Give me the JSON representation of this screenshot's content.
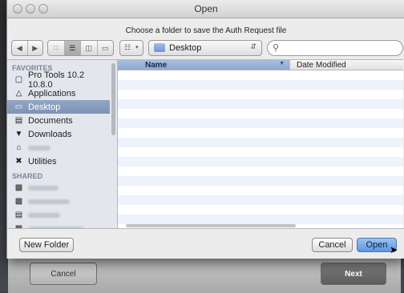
{
  "window": {
    "title": "Open",
    "prompt": "Choose a folder to save the Auth Request file"
  },
  "toolbar": {
    "back_icon": "chevron-left",
    "forward_icon": "chevron-right",
    "view_icons": [
      "icon-view",
      "list-view",
      "column-view",
      "coverflow-view"
    ],
    "arrange_icon": "arrange-grid",
    "location": "Desktop",
    "search_value": ""
  },
  "sidebar": {
    "favorites_header": "FAVORITES",
    "favorites": [
      {
        "label": "Pro Tools 10.2 10.8.0",
        "icon": "disk-icon"
      },
      {
        "label": "Applications",
        "icon": "applications-icon"
      },
      {
        "label": "Desktop",
        "icon": "desktop-icon",
        "selected": true
      },
      {
        "label": "Documents",
        "icon": "documents-icon"
      },
      {
        "label": "Downloads",
        "icon": "downloads-icon"
      },
      {
        "label": "",
        "icon": "home-icon",
        "redacted": true
      },
      {
        "label": "Utilities",
        "icon": "utilities-icon"
      }
    ],
    "shared_header": "SHARED"
  },
  "columns": {
    "name": "Name",
    "date": "Date Modified"
  },
  "footer": {
    "new_folder": "New Folder",
    "cancel": "Cancel",
    "open": "Open"
  },
  "background": {
    "cancel": "Cancel",
    "next": "Next"
  }
}
